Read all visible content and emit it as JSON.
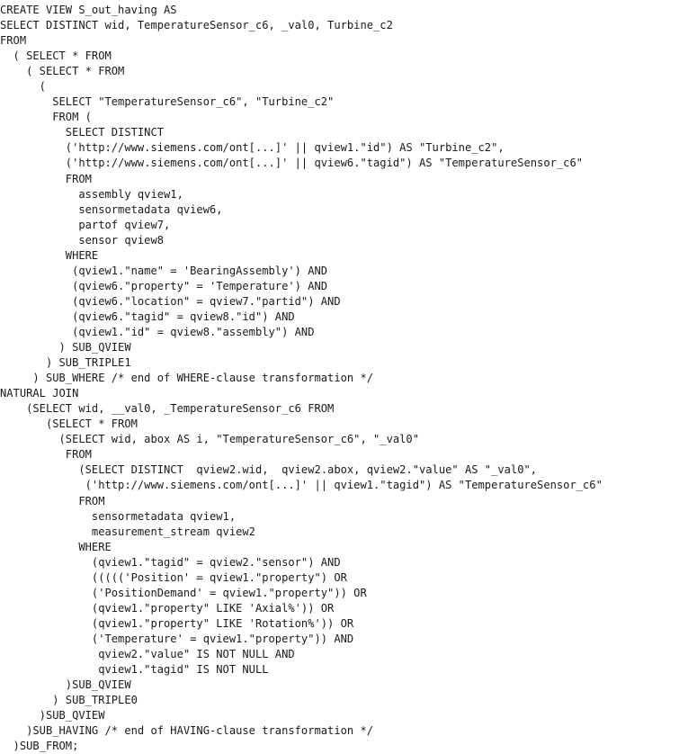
{
  "document": {
    "kind": "sql-code-listing",
    "language": "SQL",
    "title": "CREATE VIEW S_out_having",
    "background_color": "#ffffff",
    "text_color": "#1a1a1a",
    "lines": [
      "CREATE VIEW S_out_having AS",
      "SELECT DISTINCT wid, TemperatureSensor_c6, _val0, Turbine_c2",
      "FROM",
      "  ( SELECT * FROM",
      "    ( SELECT * FROM",
      "      (",
      "        SELECT \"TemperatureSensor_c6\", \"Turbine_c2\"",
      "        FROM (",
      "          SELECT DISTINCT",
      "          ('http://www.siemens.com/ont[...]' || qview1.\"id\") AS \"Turbine_c2\",",
      "          ('http://www.siemens.com/ont[...]' || qview6.\"tagid\") AS \"TemperatureSensor_c6\"",
      "          FROM",
      "            assembly qview1,",
      "            sensormetadata qview6,",
      "            partof qview7,",
      "            sensor qview8",
      "          WHERE",
      "           (qview1.\"name\" = 'BearingAssembly') AND",
      "           (qview6.\"property\" = 'Temperature') AND",
      "           (qview6.\"location\" = qview7.\"partid\") AND",
      "           (qview6.\"tagid\" = qview8.\"id\") AND",
      "           (qview1.\"id\" = qview8.\"assembly\") AND",
      "         ) SUB_QVIEW",
      "       ) SUB_TRIPLE1",
      "     ) SUB_WHERE /* end of WHERE-clause transformation */",
      "NATURAL JOIN",
      "    (SELECT wid, __val0, _TemperatureSensor_c6 FROM",
      "       (SELECT * FROM",
      "         (SELECT wid, abox AS i, \"TemperatureSensor_c6\", \"_val0\"",
      "          FROM",
      "            (SELECT DISTINCT  qview2.wid,  qview2.abox, qview2.\"value\" AS \"_val0\",",
      "             ('http://www.siemens.com/ont[...]' || qview1.\"tagid\") AS \"TemperatureSensor_c6\"",
      "            FROM",
      "              sensormetadata qview1,",
      "              measurement_stream qview2",
      "            WHERE",
      "              (qview1.\"tagid\" = qview2.\"sensor\") AND",
      "              ((((('Position' = qview1.\"property\") OR",
      "              ('PositionDemand' = qview1.\"property\")) OR",
      "              (qview1.\"property\" LIKE 'Axial%')) OR",
      "              (qview1.\"property\" LIKE 'Rotation%')) OR",
      "              ('Temperature' = qview1.\"property\")) AND",
      "               qview2.\"value\" IS NOT NULL AND",
      "               qview1.\"tagid\" IS NOT NULL",
      "          )SUB_QVIEW",
      "        ) SUB_TRIPLE0",
      "      )SUB_QVIEW",
      "    )SUB_HAVING /* end of HAVING-clause transformation */",
      "  )SUB_FROM;"
    ]
  }
}
